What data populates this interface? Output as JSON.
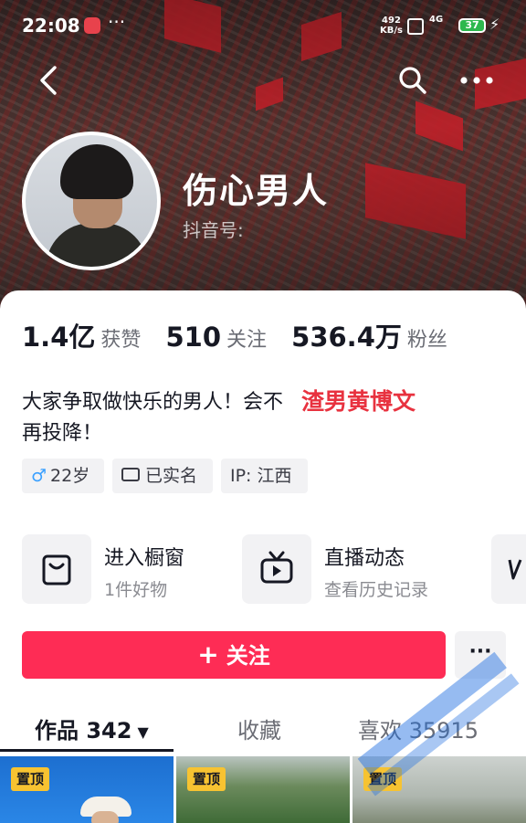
{
  "status_bar": {
    "time": "22:08",
    "dots": "···",
    "net_speed": "492\nKB/s",
    "network": "4G",
    "battery": "37",
    "battery_color": "#2db84d"
  },
  "profile": {
    "name": "伤心男人",
    "douyin_id_label": "抖音号:"
  },
  "stats": [
    {
      "value": "1.4亿",
      "label": "获赞"
    },
    {
      "value": "510",
      "label": "关注"
    },
    {
      "value": "536.4万",
      "label": "粉丝"
    }
  ],
  "bio": {
    "text": "大家争取做快乐的男人！会不再投降！",
    "tag": "渣男黄博文"
  },
  "chips": {
    "gender_symbol": "♂",
    "age": "22岁",
    "verified": "已实名",
    "ip": "IP: 江西"
  },
  "features": {
    "shop": {
      "title": "进入橱窗",
      "sub": "1件好物"
    },
    "live": {
      "title": "直播动态",
      "sub": "查看历史记录"
    }
  },
  "actions": {
    "follow_label": "关注",
    "more_label": "···"
  },
  "tabs": {
    "works": "作品 342",
    "favorites": "收藏",
    "likes": "喜欢 35915"
  },
  "grid": {
    "pin_label": "置顶"
  },
  "colors": {
    "accent": "#fe2c55",
    "tag_red": "#e8323f",
    "pin_yellow": "#f7c331"
  }
}
